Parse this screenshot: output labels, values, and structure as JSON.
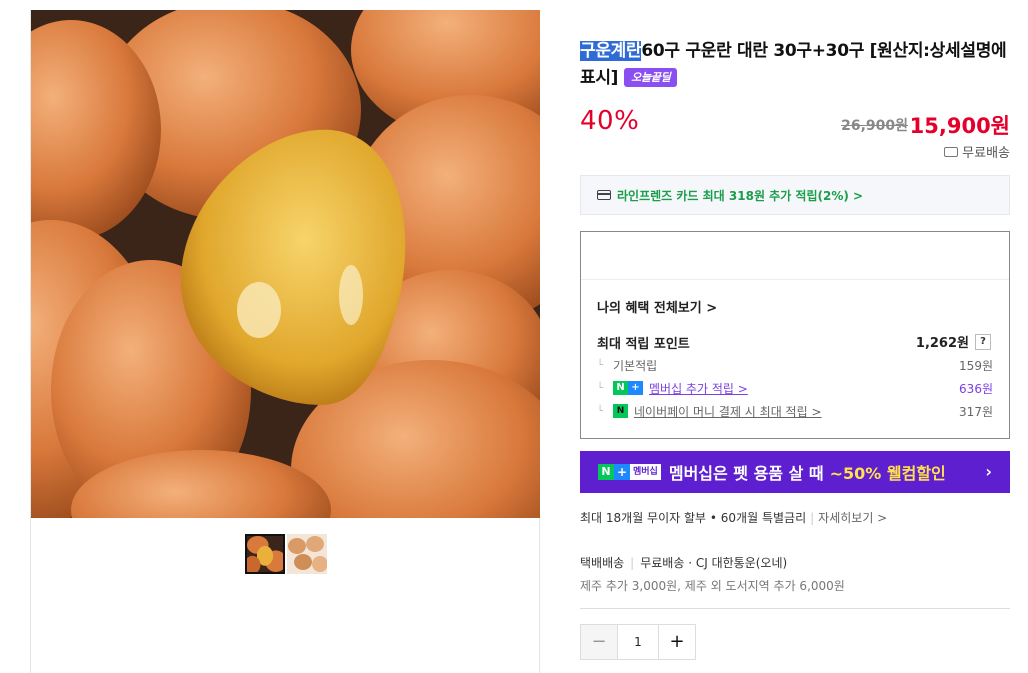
{
  "product": {
    "title_highlight": "구운계란",
    "title_rest": "60구 구운란 대란 30구+30구 [원산지:상세설명에 표시]",
    "badge": "오늘끝딜",
    "discount": "40%",
    "original_price": "26,900원",
    "sale_price": "15,900원",
    "shipping_badge": "무료배송"
  },
  "card_promo": "라인프렌즈 카드 최대 318원 추가 적립(2%) >",
  "benefits": {
    "all_link": "나의 혜택 전체보기 >",
    "max_point_label": "최대 적립 포인트",
    "max_point_value": "1,262원",
    "help": "?",
    "rows": [
      {
        "label": "기본적립",
        "value": "159원"
      },
      {
        "label": "멤버십 추가 적립 >",
        "value": "636원"
      },
      {
        "label": "네이버페이 머니 결제 시 최대 적립 >",
        "value": "317원"
      }
    ],
    "nplus_n": "N",
    "nplus_plus": "+",
    "npay_mark": "N"
  },
  "membership_banner": {
    "badge_n": "N",
    "badge_plus": "+",
    "badge_text": "멤버십",
    "text": "멤버십은 펫 용품 살 때",
    "accent": "~50% 웰컴할인",
    "arrow": "›"
  },
  "installment": {
    "text": "최대 18개월 무이자 할부 • 60개월 특별금리",
    "more": "자세히보기 >"
  },
  "shipping": {
    "method": "택배배송",
    "fee": "무료배송",
    "courier": "· CJ 대한통운(오네)",
    "extra": "제주 추가 3,000원, 제주 외 도서지역 추가 6,000원"
  },
  "quantity": {
    "minus": "−",
    "value": "1",
    "plus": "+"
  },
  "colors": {
    "sale_red": "#e4002b",
    "membership_purple": "#5e1fd0",
    "naver_green": "#03c75a"
  }
}
